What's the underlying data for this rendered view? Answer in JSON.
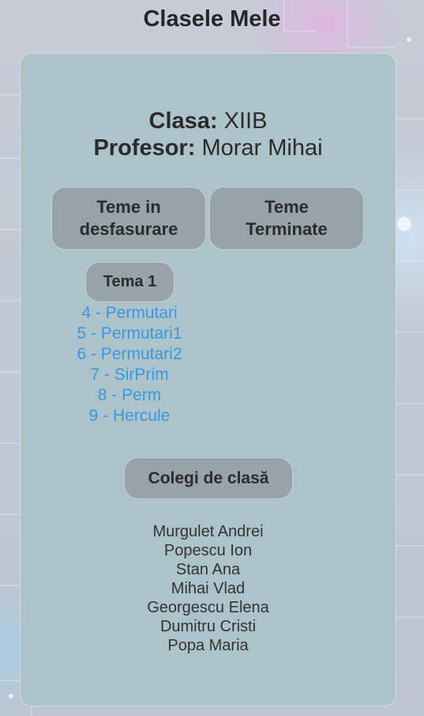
{
  "page": {
    "title": "Clasele Mele"
  },
  "class_info": {
    "class_label": "Clasa:",
    "class_value": "XIIB",
    "teacher_label": "Profesor:",
    "teacher_value": "Morar Mihai"
  },
  "tabs": {
    "in_progress_line1": "Teme in",
    "in_progress_line2": "desfasurare",
    "finished_line1": "Teme",
    "finished_line2": "Terminate"
  },
  "theme": {
    "label": "Tema 1",
    "problems": [
      "4 - Permutari",
      "5 - Permutari1",
      "6 - Permutari2",
      "7 - SirPrim",
      "8 - Perm",
      "9 - Hercule"
    ]
  },
  "classmates": {
    "button_label": "Colegi de clasă",
    "names": [
      "Murgulet Andrei",
      "Popescu Ion",
      "Stan Ana",
      "Mihai Vlad",
      "Georgescu Elena",
      "Dumitru Cristi",
      "Popa Maria"
    ]
  },
  "colors": {
    "card_background": "#adc3ca",
    "button_background": "#98a2a9",
    "link_color": "#3a97df",
    "text_color": "#2b2b2b"
  }
}
